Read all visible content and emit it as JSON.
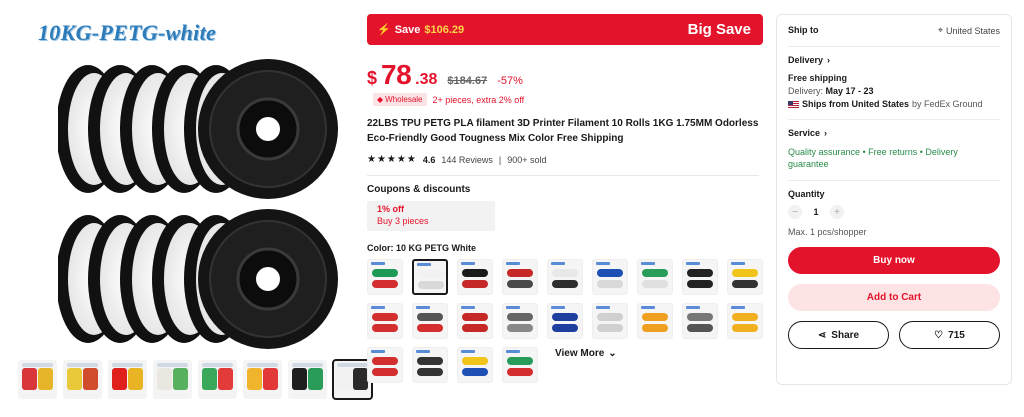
{
  "gallery": {
    "main_title": "10KG-PETG-white",
    "thumbs": [
      {
        "c1": "#d8363a",
        "c2": "#e6b52a"
      },
      {
        "c1": "#e8c93a",
        "c2": "#d04c2a"
      },
      {
        "c1": "#e0201c",
        "c2": "#e8b423"
      },
      {
        "c1": "#e9e7e0",
        "c2": "#57b15e"
      },
      {
        "c1": "#3aa85a",
        "c2": "#e33a3a"
      },
      {
        "c1": "#f0b52c",
        "c2": "#e33838"
      },
      {
        "c1": "#1e1e1e",
        "c2": "#2a9c5a"
      },
      {
        "c1": "#f2f2f2",
        "c2": "#2b2b2b"
      }
    ]
  },
  "banner": {
    "save_prefix": "Save",
    "save_amount": "$106.29",
    "big_save": "Big Save"
  },
  "price": {
    "currency": "$",
    "integer": "78",
    "decimal": ".38",
    "original": "$184.67",
    "discount": "-57%",
    "wholesale_badge": "Wholesale",
    "wholesale_text": "2+ pieces, extra 2% off"
  },
  "product": {
    "title": "22LBS TPU PETG PLA filament 3D Printer Filament 10 Rolls 1KG 1.75MM Odorless Eco-Friendly Good Tougness Mix Color Free Shipping",
    "rating": "4.6",
    "reviews": "144 Reviews",
    "sold": "900+ sold"
  },
  "coupons": {
    "heading": "Coupons & discounts",
    "coupon_title": "1% off",
    "coupon_sub": "Buy 3 pieces"
  },
  "color": {
    "heading": "Color: 10 KG PETG White",
    "view_more": "View More",
    "swatches": [
      {
        "a": "#1f9a55",
        "b": "#d32f2f"
      },
      {
        "a": "#f2f2f2",
        "b": "#d9d9d9"
      },
      {
        "a": "#1b1b1b",
        "b": "#c62828"
      },
      {
        "a": "#c62828",
        "b": "#4a4a4a"
      },
      {
        "a": "#e8e8e8",
        "b": "#2e2e2e"
      },
      {
        "a": "#1e4fb5",
        "b": "#d9d9d9"
      },
      {
        "a": "#2a9c5a",
        "b": "#e0e0e0"
      },
      {
        "a": "#222222",
        "b": "#222222"
      },
      {
        "a": "#f0c419",
        "b": "#333333"
      },
      {
        "a": "#d32f2f",
        "b": "#d32f2f"
      },
      {
        "a": "#555555",
        "b": "#d32f2f"
      },
      {
        "a": "#c62828",
        "b": "#c62828"
      },
      {
        "a": "#666666",
        "b": "#888888"
      },
      {
        "a": "#1e3fa0",
        "b": "#1e3fa0"
      },
      {
        "a": "#d0d0d0",
        "b": "#d0d0d0"
      },
      {
        "a": "#f0a020",
        "b": "#f0a020"
      },
      {
        "a": "#777777",
        "b": "#555555"
      },
      {
        "a": "#f0b020",
        "b": "#f0b020"
      },
      {
        "a": "#d32f2f",
        "b": "#d32f2f"
      },
      {
        "a": "#333333",
        "b": "#333333"
      },
      {
        "a": "#f0c419",
        "b": "#1e4fb5"
      },
      {
        "a": "#2a9c5a",
        "b": "#d32f2f"
      }
    ]
  },
  "panel": {
    "ship_to": "Ship to",
    "location": "United States",
    "delivery_h": "Delivery",
    "free_shipping": "Free shipping",
    "delivery_label": "Delivery:",
    "delivery_dates": "May 17 - 23",
    "ships_from": "Ships from United States",
    "carrier": "by FedEx Ground",
    "service_h": "Service",
    "service_text": "Quality assurance • Free returns • Delivery guarantee",
    "quantity_h": "Quantity",
    "quantity": "1",
    "max": "Max. 1 pcs/shopper",
    "buy_now": "Buy now",
    "add_to_cart": "Add to Cart",
    "share": "Share",
    "wishlist_count": "715"
  }
}
